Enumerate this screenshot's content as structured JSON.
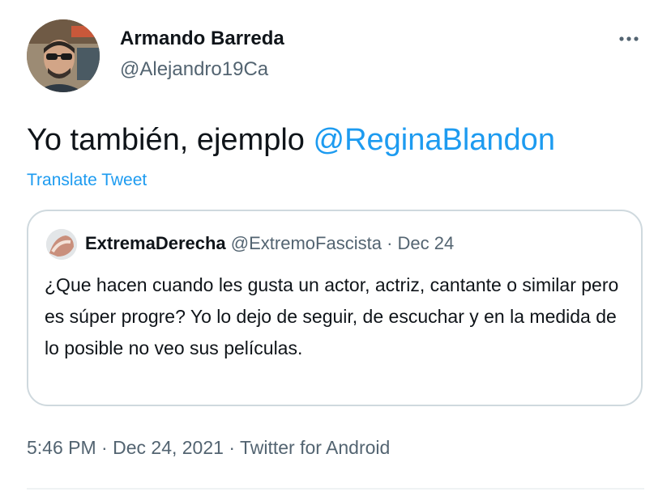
{
  "author": {
    "display_name": "Armando Barreda",
    "handle": "@Alejandro19Ca"
  },
  "tweet": {
    "text_prefix": "Yo también, ejemplo ",
    "mention": "@ReginaBlandon",
    "translate_label": "Translate Tweet",
    "more_icon": "more-horizontal-icon"
  },
  "quoted_tweet": {
    "display_name": "ExtremaDerecha",
    "handle": "@ExtremoFascista",
    "separator": " · ",
    "date": "Dec 24",
    "text": "¿Que hacen cuando les gusta un actor, actriz, cantante o similar pero es súper progre? Yo lo dejo de seguir, de escuchar y en la medida de lo posible no veo sus películas."
  },
  "meta": {
    "time": "5:46 PM",
    "separator": " · ",
    "date": "Dec 24, 2021",
    "source": "Twitter for Android"
  },
  "colors": {
    "link": "#1d9bf0",
    "secondary_text": "#536471",
    "primary_text": "#0f1419",
    "border": "#cfd9de"
  }
}
